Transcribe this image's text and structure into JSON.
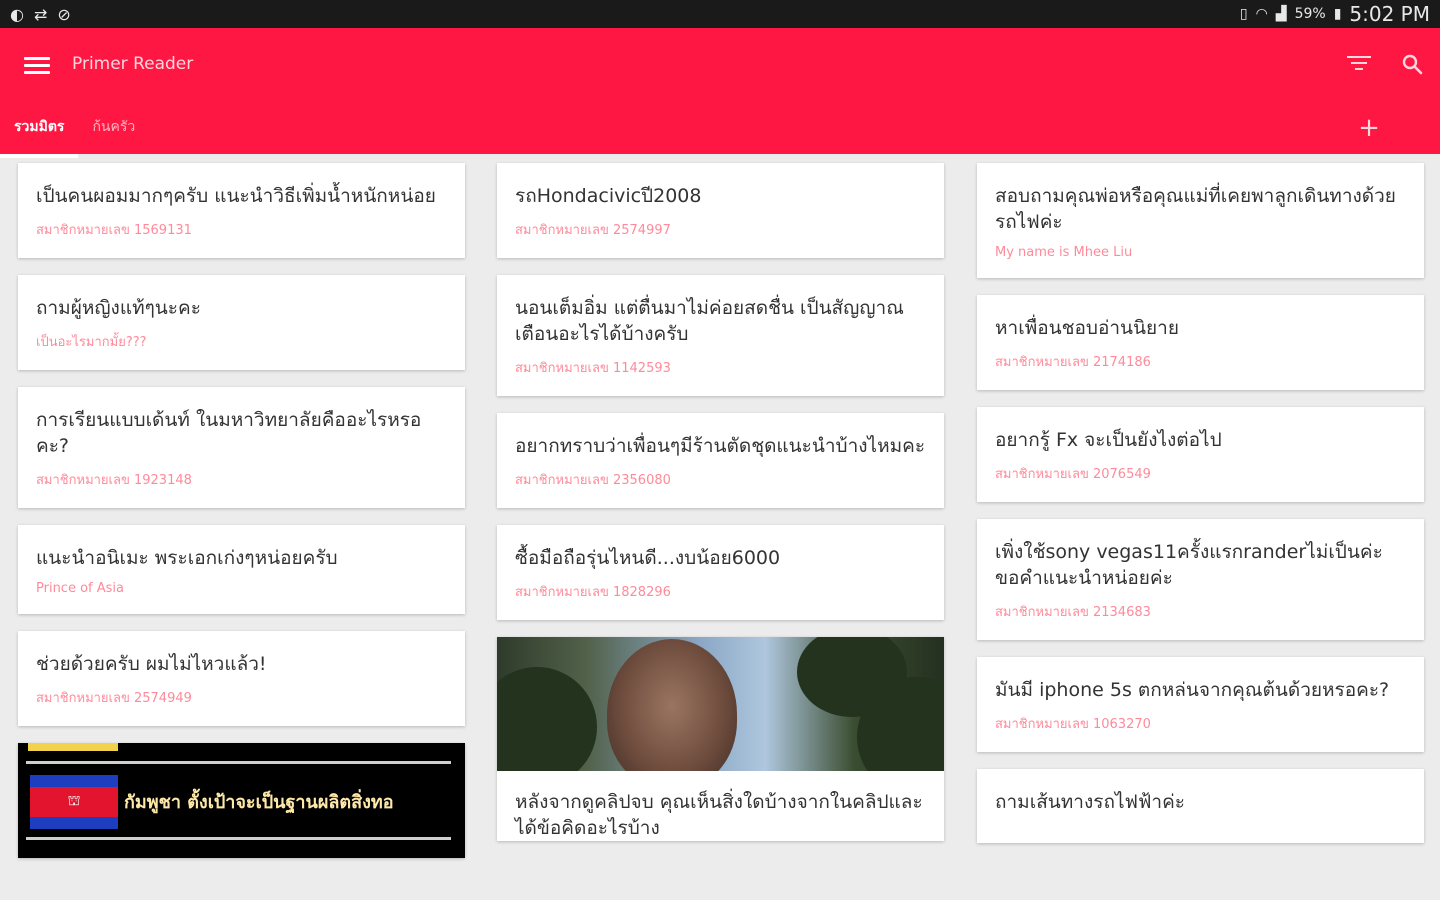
{
  "status_bar": {
    "left_icons": [
      "brightness-icon",
      "sync-icon",
      "compass-icon"
    ],
    "battery": "59%",
    "time": "5:02 PM"
  },
  "app": {
    "title": "Primer Reader",
    "tabs": [
      {
        "label": "รวมมิตร",
        "active": true
      },
      {
        "label": "ก้นครัว",
        "active": false
      }
    ]
  },
  "columns": [
    {
      "cards": [
        {
          "title": "เป็นคนผอมมากๆครับ แนะนำวิธีเพิ่มน้ำหนักหน่อย",
          "subtitle": "สมาชิกหมายเลข 1569131"
        },
        {
          "title": "ถามผู้หญิงแท้ๆนะคะ",
          "subtitle": "เป็นอะไรมากมั้ย???"
        },
        {
          "title": "การเรียนแบบเด้นท์ ในมหาวิทยาลัยคืออะไรหรอคะ?",
          "subtitle": "สมาชิกหมายเลข 1923148"
        },
        {
          "title": "แนะนำอนิเมะ พระเอกเก่งๆหน่อยครับ",
          "subtitle": "Prince of Asia"
        },
        {
          "title": "ช่วยด้วยครับ ผมไม่ไหวแล้ว!",
          "subtitle": "สมาชิกหมายเลข 2574949"
        }
      ],
      "image_card": {
        "caption": "กัมพูชา ตั้งเป้าจะเป็นฐานผลิตสิ่งทอ"
      }
    },
    {
      "cards": [
        {
          "title": "รถHondacivicปี2008",
          "subtitle": "สมาชิกหมายเลข 2574997"
        },
        {
          "title": "นอนเต็มอิ่ม แต่ตื่นมาไม่ค่อยสดชื่น เป็นสัญญาณเตือนอะไรได้บ้างครับ",
          "subtitle": "สมาชิกหมายเลข 1142593"
        },
        {
          "title": "อยากทราบว่าเพื่อนๆมีร้านตัดชุดแนะนำบ้างไหมคะ",
          "subtitle": "สมาชิกหมายเลข 2356080"
        },
        {
          "title": "ซื้อมือถือรุ่นไหนดี...งบน้อย6000",
          "subtitle": "สมาชิกหมายเลข 1828296"
        }
      ],
      "image_card": {
        "title": "หลังจากดูคลิปจบ คุณเห็นสิ่งใดบ้างจากในคลิปและได้ข้อคิดอะไรบ้าง"
      }
    },
    {
      "cards": [
        {
          "title": "สอบถามคุณพ่อหรือคุณแม่ที่เคยพาลูกเดินทางด้วยรถไฟค่ะ",
          "subtitle": "My name is Mhee Liu"
        },
        {
          "title": "หาเพื่อนชอบอ่านนิยาย",
          "subtitle": "สมาชิกหมายเลข 2174186"
        },
        {
          "title": "อยากรู้ Fx จะเป็นยังไงต่อไป",
          "subtitle": "สมาชิกหมายเลข 2076549"
        },
        {
          "title": "เพิ่งใช้sony vegas11ครั้งแรกranderไม่เป็นค่ะขอคำแนะนำหน่อยค่ะ",
          "subtitle": "สมาชิกหมายเลข 2134683"
        },
        {
          "title": "มันมี iphone 5s ตกหล่นจากคุณต้นด้วยหรอคะ?",
          "subtitle": "สมาชิกหมายเลข 1063270"
        },
        {
          "title": "ถามเส้นทางรถไฟฟ้าค่ะ",
          "subtitle": ""
        }
      ]
    }
  ],
  "colors": {
    "primary": "#ff1744",
    "subtitle": "#ff8a9a",
    "background": "#ececec"
  }
}
